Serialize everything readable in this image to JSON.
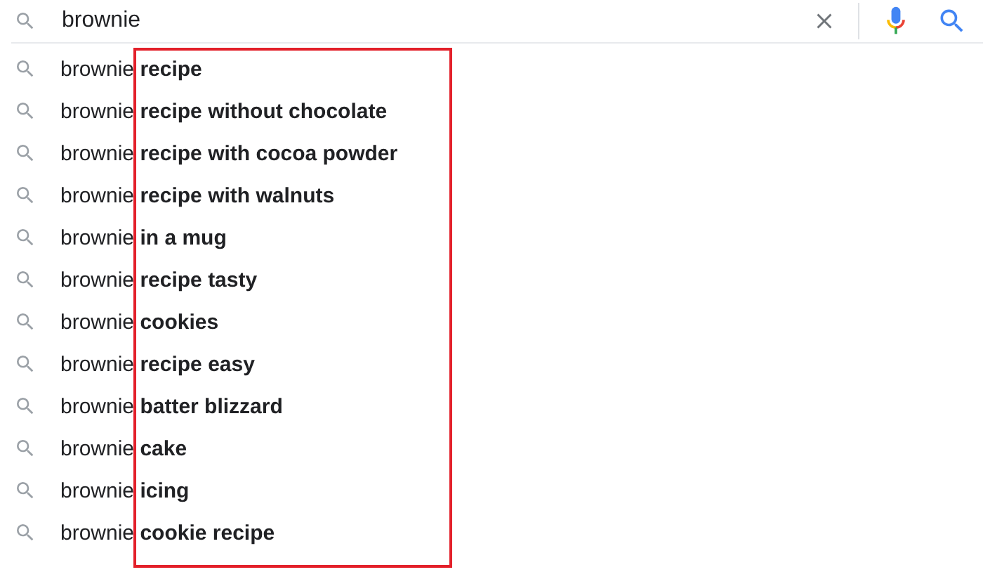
{
  "search": {
    "value": "brownie"
  },
  "suggestions": [
    {
      "text": "brownie **recipe**"
    },
    {
      "text": "brownie **recipe without chocolate**"
    },
    {
      "text": "brownie **recipe with cocoa powder**"
    },
    {
      "text": "brownie **recipe with walnuts**"
    },
    {
      "text": "brownie **in a mug**"
    },
    {
      "text": "brownie **recipe tasty**"
    },
    {
      "text": "brownie **cookies**"
    },
    {
      "text": "brownie **recipe easy**"
    },
    {
      "text": "brownie **batter blizzard**"
    },
    {
      "text": "brownie **cake**"
    },
    {
      "text": "brownie **icing**"
    },
    {
      "text": "brownie **cookie recipe**"
    }
  ]
}
